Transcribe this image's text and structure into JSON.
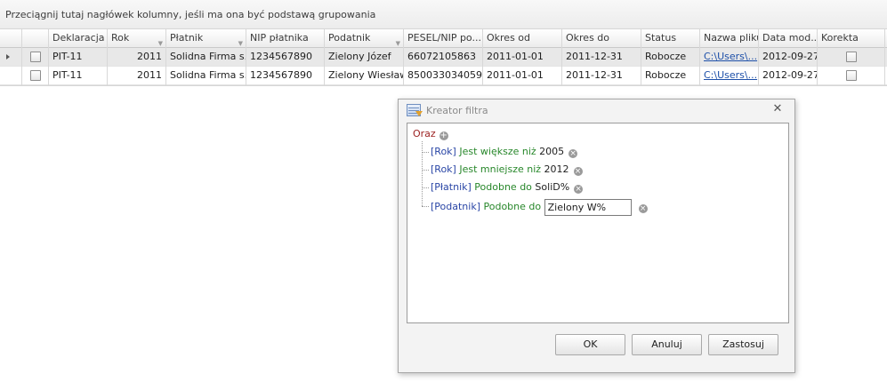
{
  "group_panel": {
    "text": "Przeciągnij tutaj nagłówek kolumny, jeśli ma ona być podstawą grupowania"
  },
  "grid": {
    "columns": [
      "Deklaracja",
      "Rok",
      "Płatnik",
      "NIP płatnika",
      "Podatnik",
      "PESEL/NIP po...",
      "Okres od",
      "Okres do",
      "Status",
      "Nazwa pliku",
      "Data mod...",
      "Korekta"
    ],
    "rows": [
      [
        "PIT-11",
        "2011",
        "Solidna Firma s...",
        "1234567890",
        "Zielony Józef",
        "66072105863",
        "2011-01-01",
        "2011-12-31",
        "Robocze",
        "C:\\Users\\...",
        "2012-09-27",
        ""
      ],
      [
        "PIT-11",
        "2011",
        "Solidna Firma s...",
        "1234567890",
        "Zielony Wiesław",
        "850033034059",
        "2011-01-01",
        "2011-12-31",
        "Robocze",
        "C:\\Users\\...",
        "2012-09-27",
        ""
      ]
    ]
  },
  "dialog": {
    "title": "Kreator filtra",
    "group_operator": "Oraz",
    "conditions": [
      {
        "field": "[Rok]",
        "operator": "Jest większe niż",
        "value": "2005"
      },
      {
        "field": "[Rok]",
        "operator": "Jest mniejsze niż",
        "value": "2012"
      },
      {
        "field": "[Płatnik]",
        "operator": "Podobne do",
        "value": "SoliD%"
      },
      {
        "field": "[Podatnik]",
        "operator": "Podobne do",
        "value": "Zielony W%"
      }
    ],
    "buttons": {
      "ok": "OK",
      "cancel": "Anuluj",
      "apply": "Zastosuj"
    }
  },
  "icons": {
    "remove": "remove-condition-icon",
    "add": "add-condition-icon",
    "close": "close-icon"
  }
}
